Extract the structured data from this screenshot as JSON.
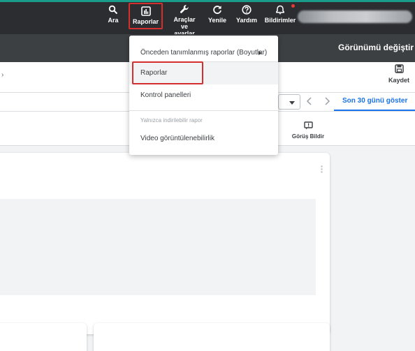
{
  "header": {
    "buttons": {
      "search": "Ara",
      "reports": "Raporlar",
      "tools_line1": "Araçlar",
      "tools_line2": "ve ayarlar",
      "refresh": "Yenile",
      "help": "Yardım",
      "notifications": "Bildirimler"
    }
  },
  "subbar": {
    "view_toggle": "Görünümü değiştir"
  },
  "actions": {
    "save": "Kaydet",
    "crumb_tail": "›"
  },
  "date": {
    "show_last_30": "Son 30 günü göster"
  },
  "feedback": {
    "label": "Görüş Bildir"
  },
  "menu": {
    "predefined": "Önceden tanımlanmış raporlar (Boyutlar)",
    "reports": "Raporlar",
    "dashboards": "Kontrol panelleri",
    "section_downloadable": "Yalnızca indirilebilir rapor",
    "video_viewability": "Video görüntülenebilirlik"
  },
  "colors": {
    "header_bg": "#2b2d31",
    "subbar_bg": "#3c4043",
    "accent_blue": "#1a73e8",
    "highlight_red": "#d32f2f"
  }
}
